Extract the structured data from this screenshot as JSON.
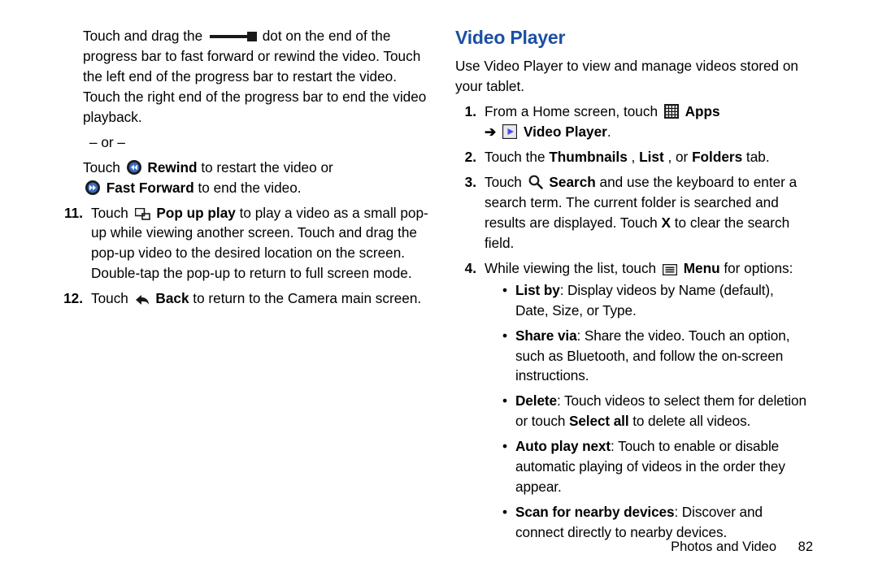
{
  "left": {
    "para1_a": "Touch and drag the ",
    "para1_b": " dot on the end of the progress bar to fast forward or rewind the video. Touch the left end of the progress bar to restart the video. Touch the right end of the progress bar to end the video playback.",
    "or": "– or –",
    "rewind_a": "Touch ",
    "rewind_b": " Rewind",
    "rewind_c": " to restart the video or ",
    "ff_a": " Fast Forward",
    "ff_b": " to end the video.",
    "items": [
      {
        "num": "11.",
        "a": "Touch ",
        "icon": "popup",
        "b": " Pop up play",
        "c": " to play a video as a small pop-up while viewing another screen. Touch and drag the pop-up video to the desired location on the screen. Double-tap the pop-up to return to full screen mode."
      },
      {
        "num": "12.",
        "a": "Touch ",
        "icon": "back",
        "b": " Back",
        "c": " to return to the Camera main screen."
      }
    ]
  },
  "right": {
    "title": "Video Player",
    "intro": "Use Video Player to view and manage videos stored on your tablet.",
    "items": [
      {
        "num": "1.",
        "a": "From a Home screen, touch ",
        "icon1": "apps",
        "b": " Apps",
        "arrow": "➔",
        "icon2": "play",
        "c": " Video Player",
        "d": "."
      },
      {
        "num": "2.",
        "a": "Touch the ",
        "b1": "Thumbnails",
        "b2": ", ",
        "b3": "List",
        "b4": ", or ",
        "b5": "Folders",
        "b6": " tab."
      },
      {
        "num": "3.",
        "a": "Touch ",
        "icon": "search",
        "b": " Search",
        "c": " and use the keyboard to enter a search term. The current folder is searched and results are displayed. Touch ",
        "x": "X",
        "d": " to clear the search field."
      },
      {
        "num": "4.",
        "a": "While viewing the list, touch ",
        "icon": "menu",
        "b": " Menu",
        "c": " for options:",
        "bullets": [
          {
            "t": "List by",
            "r": ": Display videos by Name (default), Date, Size, or Type."
          },
          {
            "t": "Share via",
            "r": ": Share the video. Touch an option, such as Bluetooth, and follow the on-screen instructions."
          },
          {
            "t": "Delete",
            "r": ": Touch videos to select them for deletion or touch ",
            "t2": "Select all",
            "r2": " to delete all videos."
          },
          {
            "t": "Auto play next",
            "r": ": Touch to enable or disable automatic playing of videos in the order they appear."
          },
          {
            "t": "Scan for nearby devices",
            "r": ": Discover and connect directly to nearby devices."
          }
        ]
      }
    ]
  },
  "footer": {
    "section": "Photos and Video",
    "page": "82"
  }
}
